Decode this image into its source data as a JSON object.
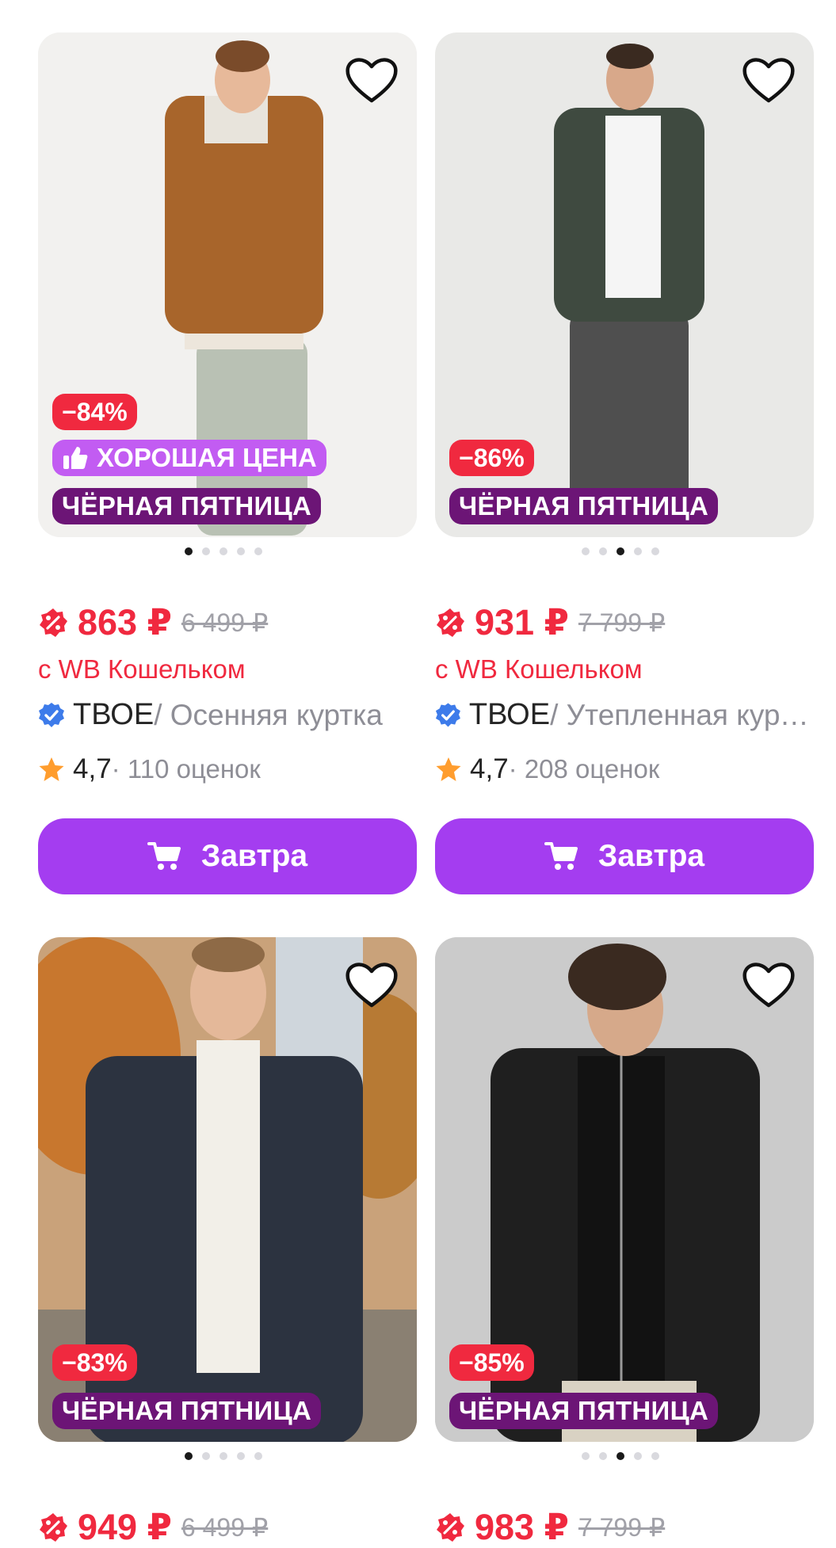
{
  "products": [
    {
      "discount": "−84%",
      "good_price_label": "ХОРОШАЯ ЦЕНА",
      "promo_label": "ЧЁРНАЯ ПЯТНИЦА",
      "active_photo": 1,
      "price": "863 ₽",
      "old_price": "6 499 ₽",
      "wallet_label": "с WB Кошельком",
      "brand": "ТВОЕ",
      "name": " / Осенняя куртка",
      "rating": "4,7",
      "reviews": " · 110 оценок",
      "button_label": "Завтра"
    },
    {
      "discount": "−86%",
      "promo_label": "ЧЁРНАЯ ПЯТНИЦА",
      "active_photo": 3,
      "price": "931 ₽",
      "old_price": "7 799 ₽",
      "wallet_label": "с WB Кошельком",
      "brand": "ТВОЕ",
      "name": " / Утепленная куртка",
      "rating": "4,7",
      "reviews": " · 208 оценок",
      "button_label": "Завтра"
    },
    {
      "discount": "−83%",
      "promo_label": "ЧЁРНАЯ ПЯТНИЦА",
      "active_photo": 1,
      "price": "949 ₽",
      "old_price": "6 499 ₽"
    },
    {
      "discount": "−85%",
      "promo_label": "ЧЁРНАЯ ПЯТНИЦА",
      "active_photo": 3,
      "price": "983 ₽",
      "old_price": "7 799 ₽"
    }
  ],
  "colors": {
    "price_red": "#f0293f",
    "button_purple": "#a43df0",
    "promo_purple": "#6c1576",
    "good_price_purple": "#c25cf2",
    "verified_blue": "#3d7bea",
    "star_orange": "#ff9d2e"
  },
  "icons": {
    "favorite": "heart-outline-icon",
    "cart": "cart-icon",
    "verified": "verified-check-icon",
    "star": "star-icon",
    "discount": "percent-badge-icon",
    "thumbs_up": "thumbs-up-icon"
  }
}
